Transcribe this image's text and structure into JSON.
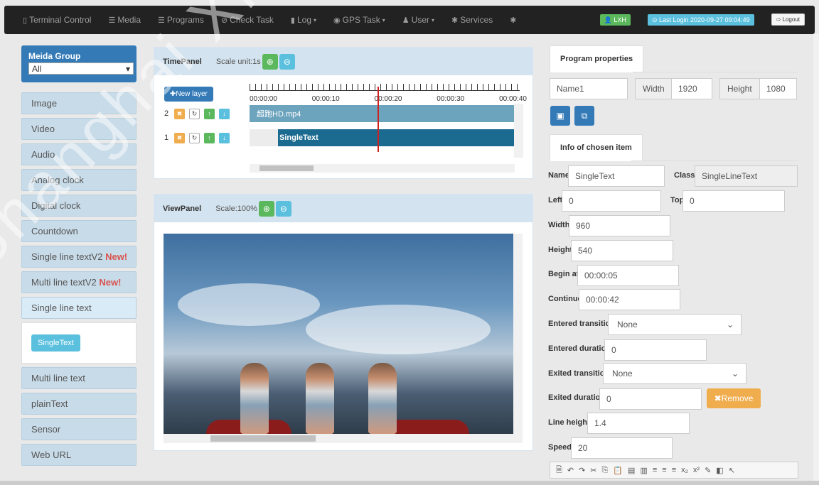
{
  "nav": {
    "items": [
      {
        "icon": "▯",
        "label": "Terminal Control",
        "caret": ""
      },
      {
        "icon": "☰",
        "label": "Media",
        "caret": ""
      },
      {
        "icon": "☰",
        "label": "Programs",
        "caret": ""
      },
      {
        "icon": "⊘",
        "label": "Check Task",
        "caret": ""
      },
      {
        "icon": "▮",
        "label": "Log",
        "caret": "▾"
      },
      {
        "icon": "◉",
        "label": "GPS Task",
        "caret": "▾"
      },
      {
        "icon": "♟",
        "label": "User",
        "caret": "▾"
      },
      {
        "icon": "✱",
        "label": "Services",
        "caret": ""
      },
      {
        "icon": "✱",
        "label": "",
        "caret": ""
      }
    ],
    "user_badge": "👤 LXH",
    "last_login": "⊙ Last Login  2020-09-27 09:04:49",
    "logout": "⇨ Logout"
  },
  "watermark": "Shanghai XiXun Electronic",
  "left": {
    "group_title": "Meida Group",
    "group_value": "All",
    "items": [
      {
        "label": "Image",
        "new": ""
      },
      {
        "label": "Video",
        "new": ""
      },
      {
        "label": "Audio",
        "new": ""
      },
      {
        "label": "Analog clock",
        "new": ""
      },
      {
        "label": "Digital clock",
        "new": ""
      },
      {
        "label": "Countdown",
        "new": ""
      },
      {
        "label": "Single line textV2",
        "new": "New!"
      },
      {
        "label": "Multi line textV2",
        "new": "New!"
      }
    ],
    "active": "Single line text",
    "sub_button": "SingleText",
    "items_after": [
      {
        "label": "Multi line text"
      },
      {
        "label": "plainText"
      },
      {
        "label": "Sensor"
      },
      {
        "label": "Web URL"
      }
    ]
  },
  "timepanel": {
    "title": "TimePanel",
    "scale": "Scale unit:1s",
    "new_layer": "✚New layer",
    "times": [
      "00:00:00",
      "00:00:10",
      "00:00:20",
      "00:00:30",
      "00:00:40"
    ],
    "layers": [
      {
        "num": "2",
        "clip": "超跑HD.mp4"
      },
      {
        "num": "1",
        "clip": "SingleText"
      }
    ]
  },
  "viewpanel": {
    "title": "ViewPanel",
    "scale": "Scale:100%"
  },
  "props": {
    "tab": "Program properties",
    "name": "Name1",
    "width_label": "Width",
    "width": "1920",
    "height_label": "Height",
    "height": "1080"
  },
  "info": {
    "tab": "Info of chosen item",
    "name_label": "Name",
    "name": "SingleText",
    "class_label": "Class",
    "class": "SingleLineText",
    "left_label": "Left",
    "left": "0",
    "top_label": "Top",
    "top": "0",
    "width_label": "Width",
    "width": "960",
    "height_label": "Height",
    "height": "540",
    "begin_label": "Begin at",
    "begin": "00:00:05",
    "continue_label": "Continue",
    "continue": "00:00:42",
    "entered_trans_label": "Entered transition",
    "entered_trans": "None",
    "entered_dur_label": "Entered duration",
    "entered_dur": "0",
    "exited_trans_label": "Exited transition",
    "exited_trans": "None",
    "exited_dur_label": "Exited duration",
    "exited_dur": "0",
    "remove": "✖Remove",
    "line_height_label": "Line height",
    "line_height": "1.4",
    "speed_label": "Speed",
    "speed": "20"
  }
}
